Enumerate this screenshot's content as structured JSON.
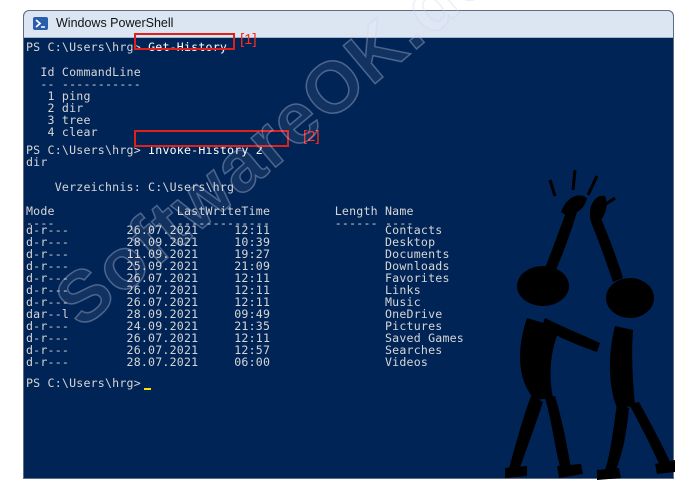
{
  "window": {
    "title": "Windows PowerShell",
    "icon": "powershell-icon",
    "background": "#012456"
  },
  "console": {
    "prompt1": "PS C:\\Users\\hrg>",
    "cmd1": "Get-History",
    "history_header": "  Id CommandLine",
    "history_sep": "  -- -----------",
    "history": [
      "   1 ping",
      "   2 dir",
      "   3 tree",
      "   4 clear"
    ],
    "prompt2": "PS C:\\Users\\hrg>",
    "cmd2": "Invoke-History 2",
    "echo": "dir",
    "dir_label": "    Verzeichnis: C:\\Users\\hrg",
    "list_header": "Mode                 LastWriteTime         Length Name",
    "list_sep": "----                 -------------         ------ ----",
    "rows": [
      "d-r---        26.07.2021     12:11                Contacts",
      "d-r---        28.09.2021     10:39                Desktop",
      "d-r---        11.09.2021     19:27                Documents",
      "d-r---        25.09.2021     21:09                Downloads",
      "d-r---        26.07.2021     12:11                Favorites",
      "d-r---        26.07.2021     12:11                Links",
      "d-r---        26.07.2021     12:11                Music",
      "dar--l        28.09.2021     09:49                OneDrive",
      "d-r---        24.09.2021     21:35                Pictures",
      "d-r---        26.07.2021     12:11                Saved Games",
      "d-r---        26.07.2021     12:57                Searches",
      "d-r---        28.07.2021     06:00                Videos"
    ],
    "prompt3": "PS C:\\Users\\hrg>"
  },
  "annotations": {
    "marker1": "[1]",
    "marker2": "[2]",
    "box_color": "#e0201b"
  },
  "watermark": "SoftwareOK.de",
  "colors": {
    "console_text": "#d6d6d6",
    "cursor": "#ffe300"
  }
}
